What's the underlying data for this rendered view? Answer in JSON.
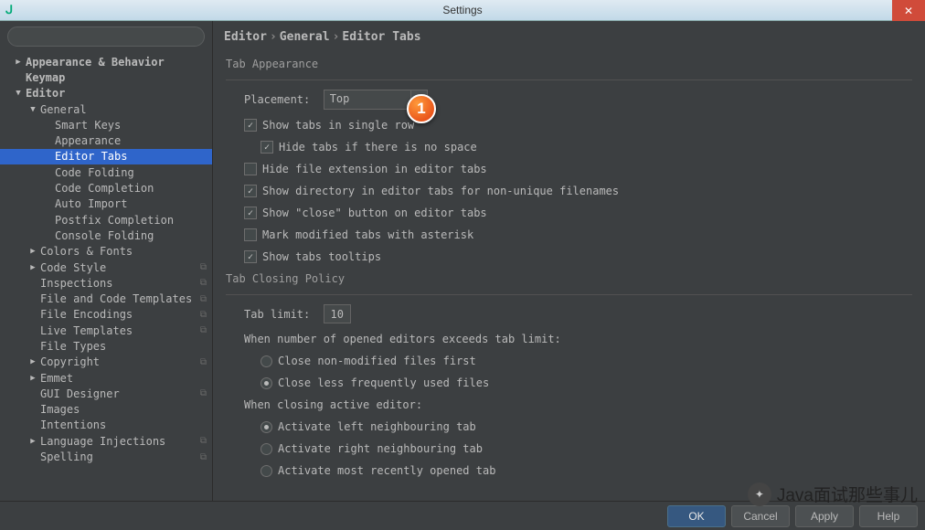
{
  "window": {
    "title": "Settings"
  },
  "search": {
    "placeholder": ""
  },
  "tree": [
    {
      "label": "Appearance & Behavior",
      "indent": 0,
      "arrow": "right",
      "bold": true
    },
    {
      "label": "Keymap",
      "indent": 0,
      "arrow": "",
      "bold": true
    },
    {
      "label": "Editor",
      "indent": 0,
      "arrow": "down",
      "bold": true
    },
    {
      "label": "General",
      "indent": 1,
      "arrow": "down"
    },
    {
      "label": "Smart Keys",
      "indent": 2,
      "arrow": ""
    },
    {
      "label": "Appearance",
      "indent": 2,
      "arrow": ""
    },
    {
      "label": "Editor Tabs",
      "indent": 2,
      "arrow": "",
      "selected": true
    },
    {
      "label": "Code Folding",
      "indent": 2,
      "arrow": ""
    },
    {
      "label": "Code Completion",
      "indent": 2,
      "arrow": ""
    },
    {
      "label": "Auto Import",
      "indent": 2,
      "arrow": ""
    },
    {
      "label": "Postfix Completion",
      "indent": 2,
      "arrow": ""
    },
    {
      "label": "Console Folding",
      "indent": 2,
      "arrow": ""
    },
    {
      "label": "Colors & Fonts",
      "indent": 1,
      "arrow": "right"
    },
    {
      "label": "Code Style",
      "indent": 1,
      "arrow": "right",
      "badge": true
    },
    {
      "label": "Inspections",
      "indent": 1,
      "arrow": "",
      "badge": true
    },
    {
      "label": "File and Code Templates",
      "indent": 1,
      "arrow": "",
      "badge": true
    },
    {
      "label": "File Encodings",
      "indent": 1,
      "arrow": "",
      "badge": true
    },
    {
      "label": "Live Templates",
      "indent": 1,
      "arrow": "",
      "badge": true
    },
    {
      "label": "File Types",
      "indent": 1,
      "arrow": ""
    },
    {
      "label": "Copyright",
      "indent": 1,
      "arrow": "right",
      "badge": true
    },
    {
      "label": "Emmet",
      "indent": 1,
      "arrow": "right"
    },
    {
      "label": "GUI Designer",
      "indent": 1,
      "arrow": "",
      "badge": true
    },
    {
      "label": "Images",
      "indent": 1,
      "arrow": ""
    },
    {
      "label": "Intentions",
      "indent": 1,
      "arrow": ""
    },
    {
      "label": "Language Injections",
      "indent": 1,
      "arrow": "right",
      "badge": true
    },
    {
      "label": "Spelling",
      "indent": 1,
      "arrow": "",
      "badge": true
    }
  ],
  "breadcrumb": [
    "Editor",
    "General",
    "Editor Tabs"
  ],
  "appearance": {
    "group_title": "Tab Appearance",
    "placement_label": "Placement:",
    "placement_value": "Top",
    "single_row": {
      "label": "Show tabs in single row",
      "checked": true
    },
    "hide_no_space": {
      "label": "Hide tabs if there is no space",
      "checked": true
    },
    "hide_ext": {
      "label": "Hide file extension in editor tabs",
      "checked": false
    },
    "show_dir": {
      "label": "Show directory in editor tabs for non-unique filenames",
      "checked": true
    },
    "show_close": {
      "label": "Show \"close\" button on editor tabs",
      "checked": true
    },
    "mark_mod": {
      "label": "Mark modified tabs with asterisk",
      "checked": false
    },
    "tooltips": {
      "label": "Show tabs tooltips",
      "checked": true
    }
  },
  "closing": {
    "group_title": "Tab Closing Policy",
    "limit_label": "Tab limit:",
    "limit_value": "10",
    "exceeds_text": "When number of opened editors exceeds tab limit:",
    "close_nonmod": {
      "label": "Close non-modified files first",
      "checked": false
    },
    "close_lfu": {
      "label": "Close less frequently used files",
      "checked": true
    },
    "closing_active_text": "When closing active editor:",
    "act_left": {
      "label": "Activate left neighbouring tab",
      "checked": true
    },
    "act_right": {
      "label": "Activate right neighbouring tab",
      "checked": false
    },
    "act_recent": {
      "label": "Activate most recently opened tab",
      "checked": false
    }
  },
  "buttons": {
    "ok": "OK",
    "cancel": "Cancel",
    "apply": "Apply",
    "help": "Help"
  },
  "marker": "1",
  "watermark": "Java面试那些事儿"
}
